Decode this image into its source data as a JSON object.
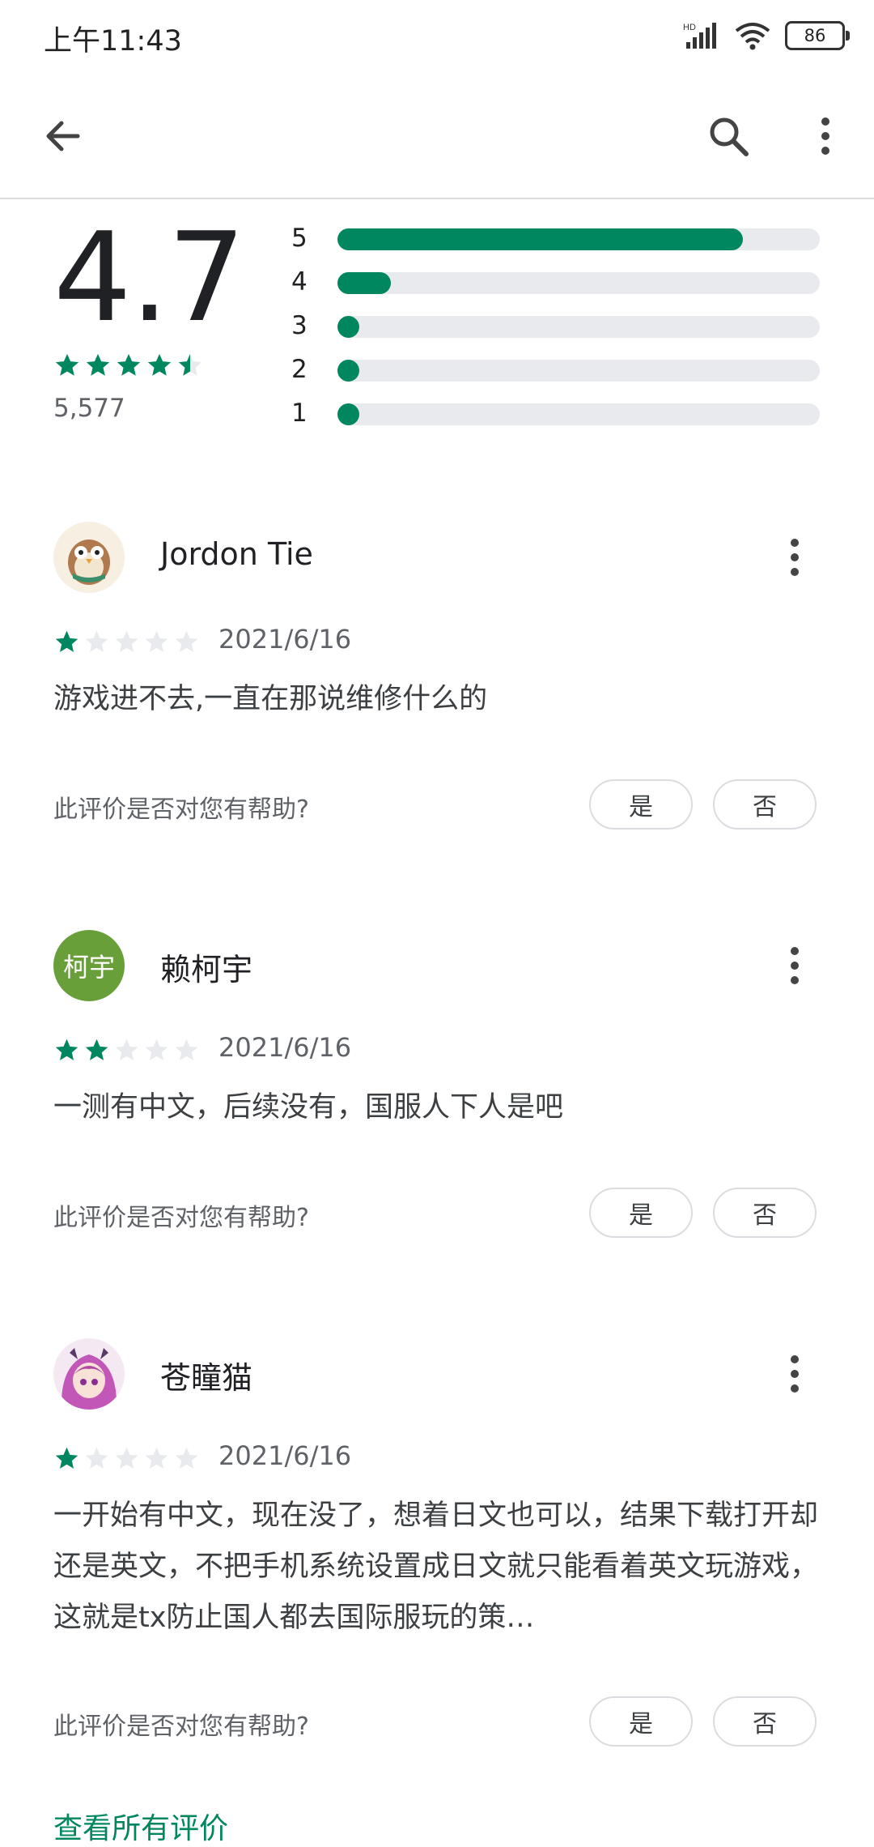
{
  "status_bar": {
    "time": "上午11:43",
    "network": "HD",
    "battery": "86"
  },
  "app_bar": {
    "back_icon": "arrow-left-icon",
    "search_icon": "search-icon",
    "more_icon": "more-vert-icon"
  },
  "rating_summary": {
    "score": "4.7",
    "stars": 4.5,
    "count": "5,577",
    "distribution": [
      {
        "label": "5",
        "fraction": 0.84
      },
      {
        "label": "4",
        "fraction": 0.11
      },
      {
        "label": "3",
        "fraction": 0.02
      },
      {
        "label": "2",
        "fraction": 0.02
      },
      {
        "label": "1",
        "fraction": 0.02
      }
    ]
  },
  "reviews": [
    {
      "name": "Jordon Tie",
      "avatar": "image",
      "stars": 1,
      "date": "2021/6/16",
      "text": "游戏进不去,一直在那说维修什么的",
      "helpful_question": "此评价是否对您有帮助?",
      "yes_label": "是",
      "no_label": "否"
    },
    {
      "name": "赖柯宇",
      "avatar_text": "柯宇",
      "stars": 2,
      "date": "2021/6/16",
      "text": "一测有中文，后续没有，国服人下人是吧",
      "helpful_question": "此评价是否对您有帮助?",
      "yes_label": "是",
      "no_label": "否"
    },
    {
      "name": "苍瞳猫",
      "avatar": "image",
      "stars": 1,
      "date": "2021/6/16",
      "text": "一开始有中文，现在没了，想着日文也可以，结果下载打开却还是英文，不把手机系统设置成日文就只能看着英文玩游戏，这就是tx防止国人都去国际服玩的策…",
      "helpful_question": "此评价是否对您有帮助?",
      "yes_label": "是",
      "no_label": "否"
    }
  ],
  "see_all": "查看所有评价",
  "colors": {
    "accent": "#01875f",
    "track": "#e8eaed",
    "star_empty": "#e8eaed"
  }
}
